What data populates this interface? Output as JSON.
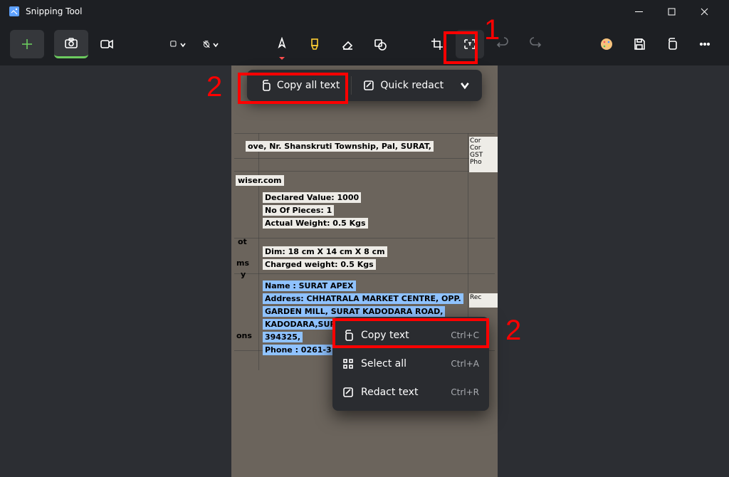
{
  "window": {
    "title": "Snipping Tool"
  },
  "actionbar": {
    "copy_all": "Copy all text",
    "quick_redact": "Quick redact"
  },
  "context_menu": {
    "copy_text": "Copy text",
    "copy_text_shortcut": "Ctrl+C",
    "select_all": "Select all",
    "select_all_shortcut": "Ctrl+A",
    "redact_text": "Redact text",
    "redact_text_shortcut": "Ctrl+R"
  },
  "annotations": {
    "num_top": "1",
    "num_left": "2",
    "num_right": "2"
  },
  "doc": {
    "line_top": "ove, Nr. Shanskruti Township, Pal, SURAT,",
    "wiser": "wiser.com",
    "declared": "Declared Value: 1000",
    "pieces": "No Of Pieces: 1",
    "actual": "Actual Weight: 0.5 Kgs",
    "dim": "Dim: 18 cm X 14 cm X 8 cm",
    "charged": "Charged weight: 0.5 Kgs",
    "name": "Name : SURAT APEX",
    "addr1": "Address: CHHATRALA MARKET CENTRE, OPP.",
    "addr2": "GARDEN MILL, SURAT KADODARA ROAD,",
    "addr3": "KADODARA,SUR",
    "pin": "394325,",
    "phone": "Phone : 0261-3",
    "side1": "ot",
    "side2": "ms",
    "side3": "y",
    "side4": "ons",
    "rightlabel1": "Cor",
    "rightlabel2": "Cor",
    "rightlabel3": "GST",
    "rightlabel4": "Pho",
    "rightlabel5": "Rec"
  }
}
